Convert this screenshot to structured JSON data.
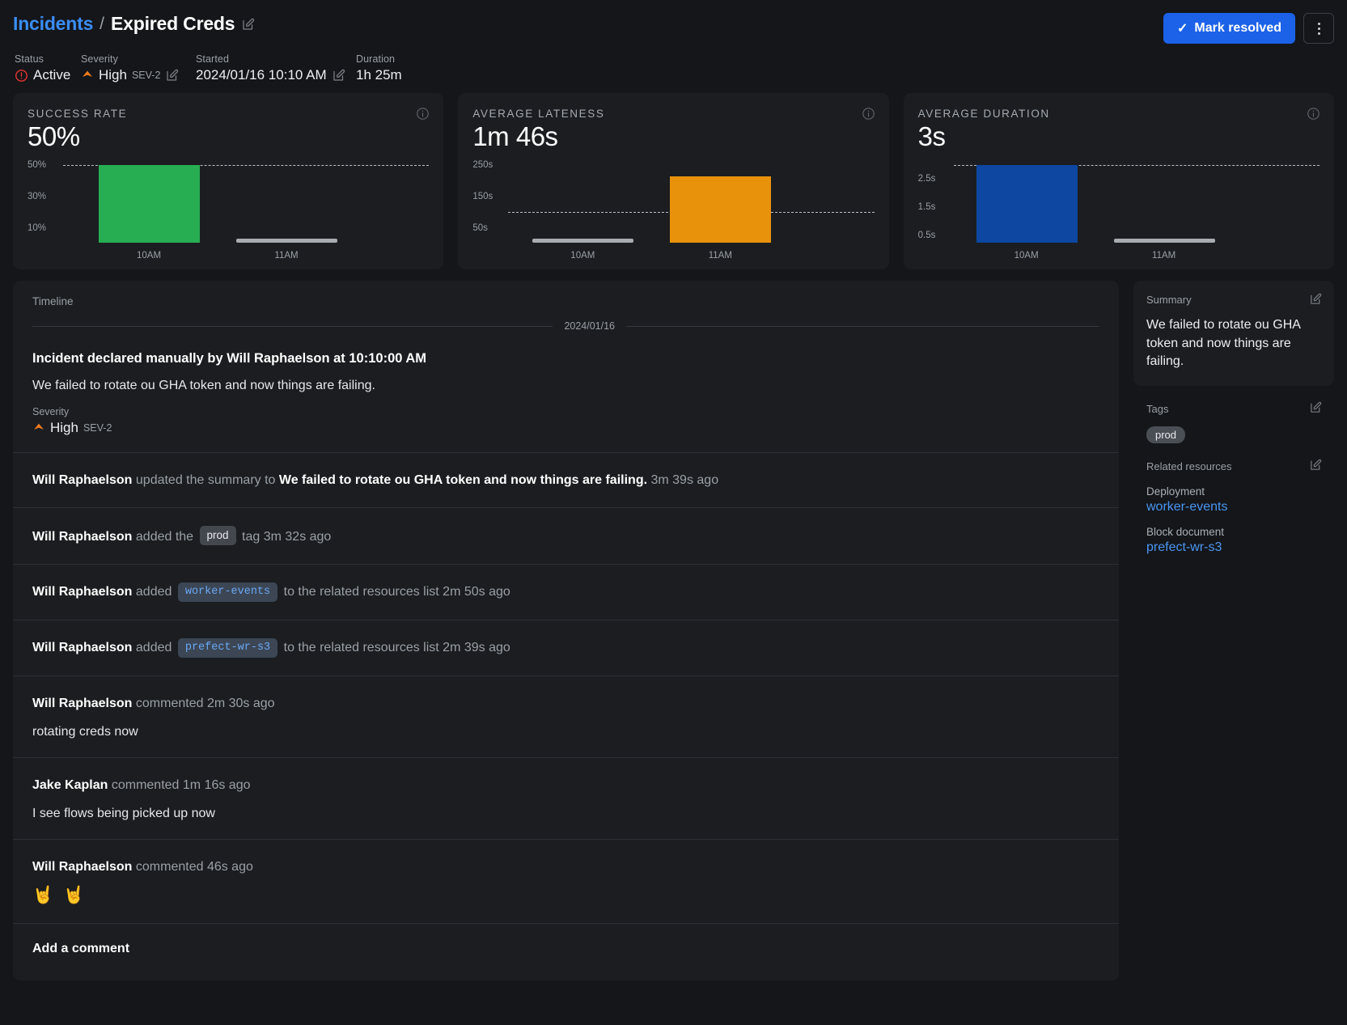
{
  "header": {
    "breadcrumb_parent": "Incidents",
    "breadcrumb_sep": "/",
    "breadcrumb_current": "Expired Creds",
    "title_edit_icon": "pencil-square-icon",
    "resolve_button": "Mark resolved",
    "resolve_check": "✓",
    "more_menu_icon": "kebab-menu-icon",
    "accent_blue": "#1c62e8"
  },
  "meta": {
    "status_label": "Status",
    "status_value": "Active",
    "status_icon": "alert-circle-icon",
    "status_color": "#e3342f",
    "severity_label": "Severity",
    "severity_value": "High",
    "severity_tag": "SEV-2",
    "severity_icon": "chevron-up-filled-icon",
    "severity_color": "#f07c1d",
    "started_label": "Started",
    "started_value": "2024/01/16 10:10 AM",
    "duration_label": "Duration",
    "duration_value": "1h 25m"
  },
  "chart_data": [
    {
      "type": "bar",
      "title": "SUCCESS RATE",
      "big_value": "50%",
      "categories": [
        "10AM",
        "11AM"
      ],
      "values": [
        50,
        1
      ],
      "ytick_labels": [
        "50%",
        "30%",
        "10%"
      ],
      "ytick_values": [
        50,
        30,
        10
      ],
      "ylim": [
        0,
        55
      ],
      "average_line": 50,
      "bar_color": "#27ae52",
      "stub_color": "#a8acb1",
      "grid": false,
      "legend": "none",
      "info_icon": "info-circle-icon"
    },
    {
      "type": "bar",
      "title": "AVERAGE LATENESS",
      "big_value": "1m 46s",
      "categories": [
        "10AM",
        "11AM"
      ],
      "values": [
        2,
        212
      ],
      "ytick_labels": [
        "250s",
        "150s",
        "50s"
      ],
      "ytick_values": [
        250,
        150,
        50
      ],
      "ylim": [
        0,
        280
      ],
      "average_line": 106,
      "bar_color": "#e8920c",
      "stub_color": "#a8acb1",
      "grid": false,
      "legend": "none",
      "info_icon": "info-circle-icon"
    },
    {
      "type": "bar",
      "title": "AVERAGE DURATION",
      "big_value": "3s",
      "categories": [
        "10AM",
        "11AM"
      ],
      "values": [
        3.0,
        0.05
      ],
      "ytick_labels": [
        "2.5s",
        "1.5s",
        "0.5s"
      ],
      "ytick_values": [
        2.5,
        1.5,
        0.5
      ],
      "ylim": [
        0,
        3.1
      ],
      "average_line": 3.0,
      "bar_color": "#0d47a1",
      "stub_color": "#a8acb1",
      "grid": false,
      "legend": "none",
      "info_icon": "info-circle-icon"
    }
  ],
  "timeline": {
    "header": "Timeline",
    "date": "2024/01/16",
    "declared": {
      "title": "Incident declared manually by Will Raphaelson at 10:10:00 AM",
      "summary": "We failed to rotate ou GHA token and now things are failing.",
      "severity_label": "Severity",
      "severity_value": "High",
      "severity_tag": "SEV-2"
    },
    "entries": [
      {
        "who": "Will Raphaelson",
        "action": "updated the summary to",
        "strong": "We failed to rotate ou GHA token and now things are failing.",
        "time": "3m 39s ago"
      },
      {
        "who": "Will Raphaelson",
        "action": "added the",
        "chip": "prod",
        "after": "tag",
        "time": "3m 32s ago"
      },
      {
        "who": "Will Raphaelson",
        "action": "added",
        "chip_res": "worker-events",
        "after": "to the related resources list",
        "time": "2m 50s ago"
      },
      {
        "who": "Will Raphaelson",
        "action": "added",
        "chip_res": "prefect-wr-s3",
        "after": "to the related resources list",
        "time": "2m 39s ago"
      },
      {
        "who": "Will Raphaelson",
        "action": "commented",
        "time": "2m 30s ago",
        "body": "rotating creds now"
      },
      {
        "who": "Jake Kaplan",
        "action": "commented",
        "time": "1m 16s ago",
        "body": "I see flows being picked up now"
      },
      {
        "who": "Will Raphaelson",
        "action": "commented",
        "time": "46s ago",
        "body_emoji": "🤘 🤘"
      }
    ],
    "add_comment": "Add a comment"
  },
  "sidebar": {
    "summary_label": "Summary",
    "summary_text": "We failed to rotate ou GHA token and now things are failing.",
    "summary_edit_icon": "pencil-square-icon",
    "tags_label": "Tags",
    "tags_edit_icon": "pencil-square-icon",
    "tags": [
      "prod"
    ],
    "related_label": "Related resources",
    "related_edit_icon": "pencil-square-icon",
    "resources": [
      {
        "kind": "Deployment",
        "name": "worker-events"
      },
      {
        "kind": "Block document",
        "name": "prefect-wr-s3"
      }
    ],
    "link_color": "#4a96f2"
  }
}
